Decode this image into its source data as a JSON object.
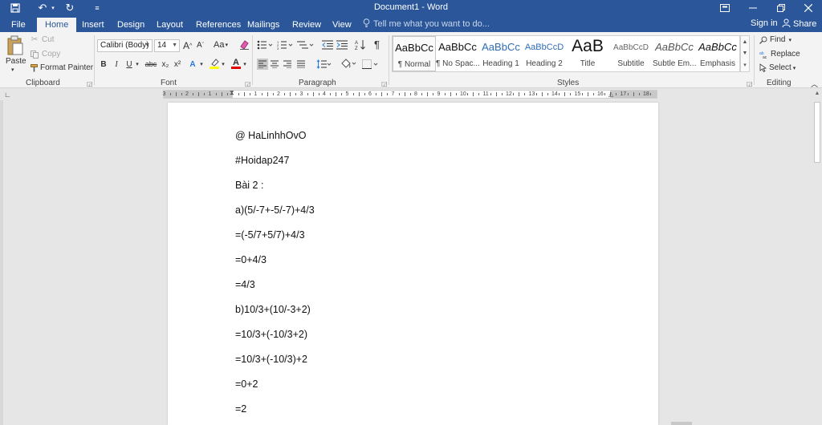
{
  "window": {
    "title": "Document1 - Word"
  },
  "tabs": [
    {
      "label": "File"
    },
    {
      "label": "Home"
    },
    {
      "label": "Insert"
    },
    {
      "label": "Design"
    },
    {
      "label": "Layout"
    },
    {
      "label": "References"
    },
    {
      "label": "Mailings"
    },
    {
      "label": "Review"
    },
    {
      "label": "View"
    }
  ],
  "tell_me": "Tell me what you want to do...",
  "account": {
    "sign_in": "Sign in",
    "share": "Share"
  },
  "clipboard": {
    "paste": "Paste",
    "cut": "Cut",
    "copy": "Copy",
    "format_painter": "Format Painter",
    "label": "Clipboard"
  },
  "font": {
    "name": "Calibri (Body)",
    "size": "14",
    "label": "Font",
    "grow": "A",
    "shrink": "A",
    "change_case": "Aa",
    "bold": "B",
    "italic": "I",
    "underline": "U",
    "strike": "abc",
    "subscript": "x₂",
    "superscript": "x²",
    "font_color_letter": "A",
    "text_effects_letter": "A",
    "highlight_color": "#ffff00",
    "font_color": "#e00000"
  },
  "paragraph": {
    "label": "Paragraph"
  },
  "styles": {
    "label": "Styles",
    "items": [
      {
        "sample": "AaBbCc",
        "name": "¶ Normal"
      },
      {
        "sample": "AaBbCc",
        "name": "¶ No Spac..."
      },
      {
        "sample": "AaBbCc",
        "name": "Heading 1"
      },
      {
        "sample": "AaBbCcD",
        "name": "Heading 2"
      },
      {
        "sample": "AaB",
        "name": "Title"
      },
      {
        "sample": "AaBbCcD",
        "name": "Subtitle"
      },
      {
        "sample": "AaBbCc",
        "name": "Subtle Em..."
      },
      {
        "sample": "AaBbCc",
        "name": "Emphasis"
      }
    ]
  },
  "editing": {
    "label": "Editing",
    "find": "Find",
    "replace": "Replace",
    "select": "Select"
  },
  "ruler": {
    "numbers": [
      "3",
      "2",
      "1",
      "1",
      "2",
      "3",
      "4",
      "5",
      "6",
      "7",
      "8",
      "9",
      "10",
      "11",
      "12",
      "13",
      "14",
      "15",
      "16",
      "17",
      "18"
    ]
  },
  "document": {
    "paragraphs": [
      "@ HaLinhhOvO",
      "#Hoidap247",
      "Bài 2 :",
      "a)(5/-7+-5/-7)+4/3",
      "=(-5/7+5/7)+4/3",
      "=0+4/3",
      "=4/3",
      "b)10/3+(10/-3+2)",
      "=10/3+(-10/3+2)",
      "=10/3+(-10/3)+2",
      "=0+2",
      "=2"
    ]
  },
  "theme": {
    "brand": "#2b579a"
  }
}
